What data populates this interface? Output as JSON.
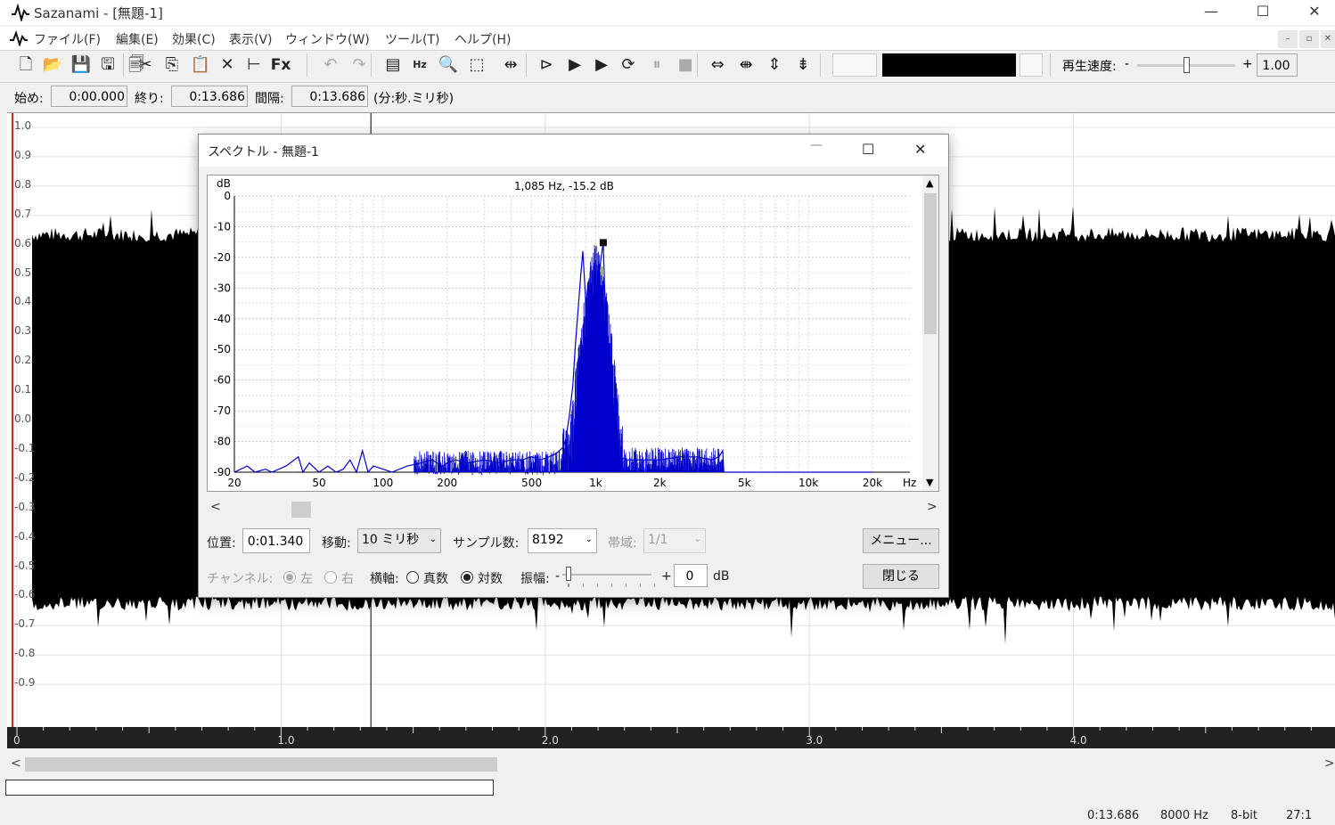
{
  "app": {
    "title": "Sazanami - [無題-1]",
    "minimize": "—",
    "maximize": "☐",
    "close": "✕"
  },
  "menu": [
    "ファイル(F)",
    "編集(E)",
    "効果(C)",
    "表示(V)",
    "ウィンドウ(W)",
    "ツール(T)",
    "ヘルプ(H)"
  ],
  "mdi_buttons": [
    "–",
    "▫",
    "✕"
  ],
  "toolbar": {
    "icons": [
      "new-file-icon",
      "open-folder-icon",
      "save-icon",
      "save-as-icon",
      "properties-icon",
      "cut-icon",
      "copy-icon",
      "paste-icon",
      "delete-icon",
      "trim-icon",
      "effects-fx-icon",
      "undo-icon",
      "redo-icon",
      "spectrum-icon",
      "hz-ch-icon",
      "zoom-icon",
      "select-shape-icon",
      "fit-icon",
      "play-selection-icon",
      "play-icon",
      "play-all-icon",
      "loop-icon",
      "pause-icon",
      "stop-icon",
      "zoom-in-h-icon",
      "zoom-out-h-icon",
      "zoom-in-v-icon",
      "zoom-out-v-icon"
    ],
    "speed_label": "再生速度:",
    "speed_minus": "-",
    "speed_plus": "+",
    "speed_value": "1.00"
  },
  "selection": {
    "start_label": "始め:",
    "start_value": "0:00.000",
    "end_label": "終り:",
    "end_value": "0:13.686",
    "interval_label": "間隔:",
    "interval_value": "0:13.686",
    "unit_note": "(分:秒.ミリ秒)"
  },
  "waveform": {
    "y_labels": [
      "1.0",
      "0.9",
      "0.8",
      "0.7",
      "0.6",
      "0.5",
      "0.4",
      "0.3",
      "0.2",
      "0.1",
      "0.0",
      "-0.1",
      "-0.2",
      "-0.3",
      "-0.4",
      "-0.5",
      "-0.6",
      "-0.7",
      "-0.8",
      "-0.9"
    ],
    "time_labels": [
      "0",
      "1.0",
      "2.0",
      "3.0",
      "4.0"
    ],
    "cursor_time": 1.34
  },
  "status": {
    "length": "0:13.686",
    "rate": "8000 Hz",
    "bits": "8-bit",
    "zoom": "27:1"
  },
  "spectrum_dialog": {
    "title": "スペクトル - 無題-1",
    "readout": "1,085 Hz,  -15.2 dB",
    "y_unit": "dB",
    "x_unit": "Hz",
    "position_label": "位置:",
    "position_value": "0:01.340",
    "move_label": "移動:",
    "move_value": "10 ミリ秒",
    "samples_label": "サンプル数:",
    "samples_value": "8192",
    "band_label": "帯域:",
    "band_value": "1/1",
    "menu_button": "メニュー...",
    "close_button": "閉じる",
    "channel_label": "チャンネル:",
    "left_label": "左",
    "right_label": "右",
    "haxis_label": "横軸:",
    "linear_label": "真数",
    "log_label": "対数",
    "amp_label": "振幅:",
    "amp_minus": "-",
    "amp_plus": "+",
    "amp_value": "0",
    "amp_unit": "dB"
  },
  "chart_data": {
    "type": "line",
    "title": "1,085 Hz,  -15.2 dB",
    "xlabel": "Hz",
    "ylabel": "dB",
    "xscale": "log",
    "xlim": [
      20,
      30000
    ],
    "ylim": [
      -90,
      0
    ],
    "x_ticks": [
      "20",
      "50",
      "100",
      "200",
      "500",
      "1k",
      "2k",
      "5k",
      "10k",
      "20k"
    ],
    "y_ticks": [
      "0",
      "-10",
      "-20",
      "-30",
      "-40",
      "-50",
      "-60",
      "-70",
      "-80",
      "-90"
    ],
    "grid": true,
    "series_color": "#0000cc",
    "series": [
      {
        "x": [
          20,
          23,
          25,
          28,
          30,
          35,
          40,
          42,
          45,
          50,
          55,
          60,
          65,
          70,
          75,
          80,
          85,
          90,
          100,
          110,
          130,
          150,
          170,
          190,
          200,
          220,
          250,
          300,
          350,
          400,
          450,
          500,
          550,
          600,
          650,
          700,
          720,
          750,
          780,
          800,
          820,
          850,
          870,
          900,
          920,
          950,
          980,
          1000,
          1020,
          1040,
          1060,
          1085,
          1100,
          1120,
          1150,
          1180,
          1200,
          1250,
          1300,
          1400,
          1500,
          1700,
          2000,
          2500,
          3000,
          3500,
          3800,
          3950,
          4000,
          5000,
          10000,
          20000
        ],
        "y": [
          -90,
          -88,
          -90,
          -89,
          -90,
          -88,
          -85,
          -90,
          -87,
          -90,
          -88,
          -90,
          -89,
          -86,
          -90,
          -83,
          -90,
          -88,
          -89,
          -90,
          -88,
          -87,
          -86,
          -88,
          -87,
          -86,
          -87,
          -86,
          -87,
          -86,
          -86,
          -85,
          -86,
          -85,
          -84,
          -82,
          -80,
          -72,
          -62,
          -50,
          -40,
          -26,
          -18,
          -36,
          -28,
          -45,
          -48,
          -40,
          -44,
          -26,
          -20,
          -15.2,
          -30,
          -38,
          -50,
          -60,
          -75,
          -86,
          -85,
          -86,
          -86,
          -86,
          -86,
          -85,
          -85,
          -86,
          -85,
          -83,
          -90,
          -90,
          -90,
          -90
        ]
      }
    ]
  }
}
